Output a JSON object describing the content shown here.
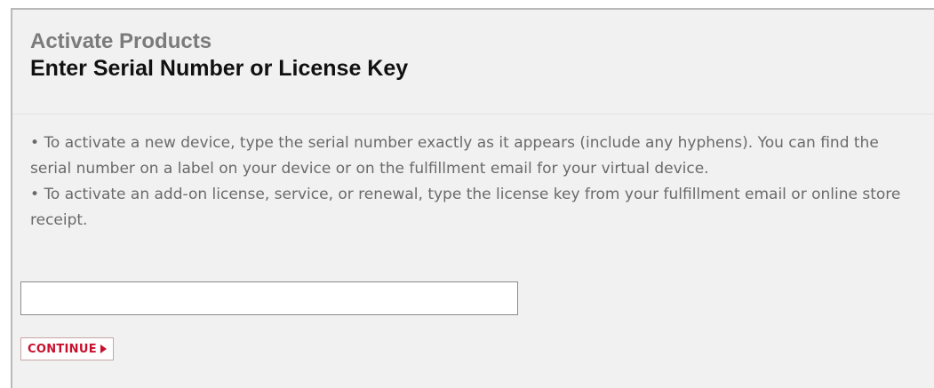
{
  "header": {
    "section_title": "Activate Products",
    "page_title": "Enter Serial Number or License Key"
  },
  "instructions": {
    "items": [
      "To activate a new device, type the serial number exactly as it appears (include any hyphens). You can find the serial number on a label on your device or on the fulfillment email for your virtual device.",
      "To activate an add-on license, service, or renewal, type the license key from your fulfillment email or online store receipt."
    ],
    "bullet": "•"
  },
  "form": {
    "serial_input_value": "",
    "continue_label": "CONTINUE",
    "continue_icon": "play-arrow-icon"
  },
  "colors": {
    "accent": "#c8102e",
    "panel_background": "#f1f1f1",
    "section_title": "#7b7b7b",
    "body_text": "#6a6a6a"
  }
}
